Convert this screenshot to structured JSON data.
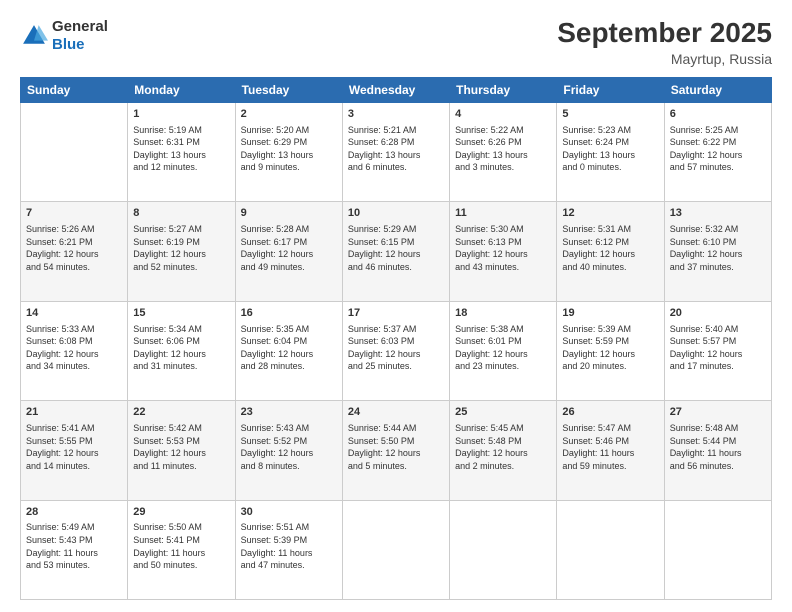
{
  "header": {
    "logo": {
      "general": "General",
      "blue": "Blue"
    },
    "title": "September 2025",
    "location": "Mayrtup, Russia"
  },
  "columns": [
    "Sunday",
    "Monday",
    "Tuesday",
    "Wednesday",
    "Thursday",
    "Friday",
    "Saturday"
  ],
  "weeks": [
    [
      {
        "day": "",
        "info": ""
      },
      {
        "day": "1",
        "info": "Sunrise: 5:19 AM\nSunset: 6:31 PM\nDaylight: 13 hours\nand 12 minutes."
      },
      {
        "day": "2",
        "info": "Sunrise: 5:20 AM\nSunset: 6:29 PM\nDaylight: 13 hours\nand 9 minutes."
      },
      {
        "day": "3",
        "info": "Sunrise: 5:21 AM\nSunset: 6:28 PM\nDaylight: 13 hours\nand 6 minutes."
      },
      {
        "day": "4",
        "info": "Sunrise: 5:22 AM\nSunset: 6:26 PM\nDaylight: 13 hours\nand 3 minutes."
      },
      {
        "day": "5",
        "info": "Sunrise: 5:23 AM\nSunset: 6:24 PM\nDaylight: 13 hours\nand 0 minutes."
      },
      {
        "day": "6",
        "info": "Sunrise: 5:25 AM\nSunset: 6:22 PM\nDaylight: 12 hours\nand 57 minutes."
      }
    ],
    [
      {
        "day": "7",
        "info": "Sunrise: 5:26 AM\nSunset: 6:21 PM\nDaylight: 12 hours\nand 54 minutes."
      },
      {
        "day": "8",
        "info": "Sunrise: 5:27 AM\nSunset: 6:19 PM\nDaylight: 12 hours\nand 52 minutes."
      },
      {
        "day": "9",
        "info": "Sunrise: 5:28 AM\nSunset: 6:17 PM\nDaylight: 12 hours\nand 49 minutes."
      },
      {
        "day": "10",
        "info": "Sunrise: 5:29 AM\nSunset: 6:15 PM\nDaylight: 12 hours\nand 46 minutes."
      },
      {
        "day": "11",
        "info": "Sunrise: 5:30 AM\nSunset: 6:13 PM\nDaylight: 12 hours\nand 43 minutes."
      },
      {
        "day": "12",
        "info": "Sunrise: 5:31 AM\nSunset: 6:12 PM\nDaylight: 12 hours\nand 40 minutes."
      },
      {
        "day": "13",
        "info": "Sunrise: 5:32 AM\nSunset: 6:10 PM\nDaylight: 12 hours\nand 37 minutes."
      }
    ],
    [
      {
        "day": "14",
        "info": "Sunrise: 5:33 AM\nSunset: 6:08 PM\nDaylight: 12 hours\nand 34 minutes."
      },
      {
        "day": "15",
        "info": "Sunrise: 5:34 AM\nSunset: 6:06 PM\nDaylight: 12 hours\nand 31 minutes."
      },
      {
        "day": "16",
        "info": "Sunrise: 5:35 AM\nSunset: 6:04 PM\nDaylight: 12 hours\nand 28 minutes."
      },
      {
        "day": "17",
        "info": "Sunrise: 5:37 AM\nSunset: 6:03 PM\nDaylight: 12 hours\nand 25 minutes."
      },
      {
        "day": "18",
        "info": "Sunrise: 5:38 AM\nSunset: 6:01 PM\nDaylight: 12 hours\nand 23 minutes."
      },
      {
        "day": "19",
        "info": "Sunrise: 5:39 AM\nSunset: 5:59 PM\nDaylight: 12 hours\nand 20 minutes."
      },
      {
        "day": "20",
        "info": "Sunrise: 5:40 AM\nSunset: 5:57 PM\nDaylight: 12 hours\nand 17 minutes."
      }
    ],
    [
      {
        "day": "21",
        "info": "Sunrise: 5:41 AM\nSunset: 5:55 PM\nDaylight: 12 hours\nand 14 minutes."
      },
      {
        "day": "22",
        "info": "Sunrise: 5:42 AM\nSunset: 5:53 PM\nDaylight: 12 hours\nand 11 minutes."
      },
      {
        "day": "23",
        "info": "Sunrise: 5:43 AM\nSunset: 5:52 PM\nDaylight: 12 hours\nand 8 minutes."
      },
      {
        "day": "24",
        "info": "Sunrise: 5:44 AM\nSunset: 5:50 PM\nDaylight: 12 hours\nand 5 minutes."
      },
      {
        "day": "25",
        "info": "Sunrise: 5:45 AM\nSunset: 5:48 PM\nDaylight: 12 hours\nand 2 minutes."
      },
      {
        "day": "26",
        "info": "Sunrise: 5:47 AM\nSunset: 5:46 PM\nDaylight: 11 hours\nand 59 minutes."
      },
      {
        "day": "27",
        "info": "Sunrise: 5:48 AM\nSunset: 5:44 PM\nDaylight: 11 hours\nand 56 minutes."
      }
    ],
    [
      {
        "day": "28",
        "info": "Sunrise: 5:49 AM\nSunset: 5:43 PM\nDaylight: 11 hours\nand 53 minutes."
      },
      {
        "day": "29",
        "info": "Sunrise: 5:50 AM\nSunset: 5:41 PM\nDaylight: 11 hours\nand 50 minutes."
      },
      {
        "day": "30",
        "info": "Sunrise: 5:51 AM\nSunset: 5:39 PM\nDaylight: 11 hours\nand 47 minutes."
      },
      {
        "day": "",
        "info": ""
      },
      {
        "day": "",
        "info": ""
      },
      {
        "day": "",
        "info": ""
      },
      {
        "day": "",
        "info": ""
      }
    ]
  ]
}
